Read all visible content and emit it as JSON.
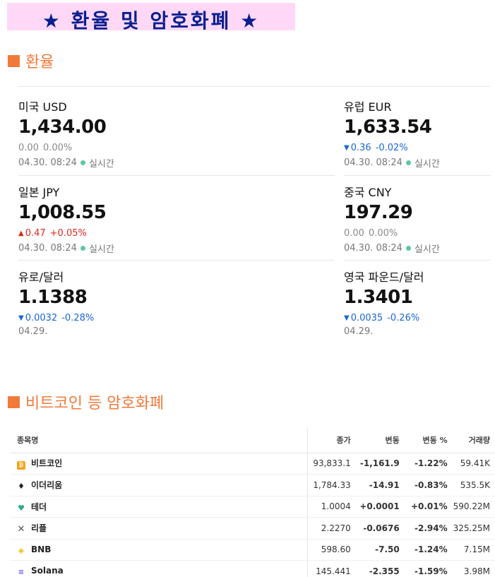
{
  "banner": {
    "title": "★ 환율 및 암호화폐 ★"
  },
  "sections": {
    "rates_title": "환율",
    "crypto_title": "비트코인 등 암호화폐"
  },
  "colors": {
    "accent": "#f07a3a",
    "banner_bg": "#ffd8f8",
    "banner_text": "#0a1f8f",
    "up": "#e0261c",
    "down": "#1a66d6",
    "flat": "#8a8a8a",
    "live_dot": "#5cc8a0"
  },
  "rates": [
    {
      "name": "미국 USD",
      "value": "1,434.00",
      "direction": "flat",
      "arrow": "",
      "change": "0.00",
      "percent": "0.00%",
      "date": "04.30. 08:24",
      "live": "실시간"
    },
    {
      "name": "유럽 EUR",
      "value": "1,633.54",
      "direction": "down",
      "arrow": "▼",
      "change": "0.36",
      "percent": "-0.02%",
      "date": "04.30. 08:24",
      "live": "실시간"
    },
    {
      "name": "일본 JPY",
      "value": "1,008.55",
      "direction": "up",
      "arrow": "▲",
      "change": "0.47",
      "percent": "+0.05%",
      "date": "04.30. 08:24",
      "live": "실시간"
    },
    {
      "name": "중국 CNY",
      "value": "197.29",
      "direction": "flat",
      "arrow": "",
      "change": "0.00",
      "percent": "0.00%",
      "date": "04.30. 08:24",
      "live": "실시간"
    },
    {
      "name": "유로/달러",
      "value": "1.1388",
      "direction": "down",
      "arrow": "▼",
      "change": "0.0032",
      "percent": "-0.28%",
      "date": "04.29.",
      "live": ""
    },
    {
      "name": "영국 파운드/달러",
      "value": "1.3401",
      "direction": "down",
      "arrow": "▼",
      "change": "0.0035",
      "percent": "-0.26%",
      "date": "04.29.",
      "live": ""
    }
  ],
  "crypto_table": {
    "headers": {
      "name": "종목명",
      "price": "종가",
      "change": "변동",
      "percent": "변동 %",
      "volume": "거래량"
    },
    "rows": [
      {
        "icon": "bitcoin-icon",
        "name": "비트코인",
        "price": "93,833.1",
        "change": "-1,161.9",
        "percent": "-1.22%",
        "volume": "59.41K"
      },
      {
        "icon": "ethereum-icon",
        "name": "이더리움",
        "price": "1,784.33",
        "change": "-14.91",
        "percent": "-0.83%",
        "volume": "535.5K"
      },
      {
        "icon": "tether-icon",
        "name": "테더",
        "price": "1.0004",
        "change": "+0.0001",
        "percent": "+0.01%",
        "volume": "590.22M"
      },
      {
        "icon": "xrp-icon",
        "name": "리플",
        "price": "2.2270",
        "change": "-0.0676",
        "percent": "-2.94%",
        "volume": "325.25M"
      },
      {
        "icon": "bnb-icon",
        "name": "BNB",
        "price": "598.60",
        "change": "-7.50",
        "percent": "-1.24%",
        "volume": "7.15M"
      },
      {
        "icon": "solana-icon",
        "name": "Solana",
        "price": "145.441",
        "change": "-2.355",
        "percent": "-1.59%",
        "volume": "3.98M"
      }
    ]
  }
}
